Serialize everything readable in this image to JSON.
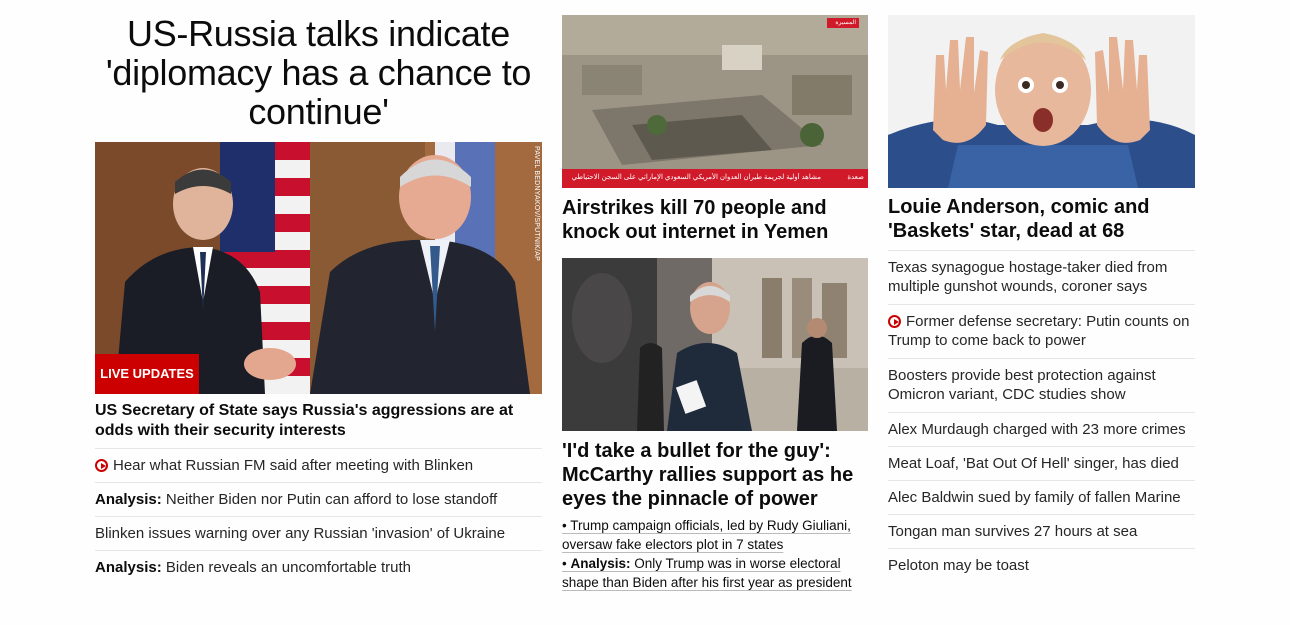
{
  "lead": {
    "headline": "US-Russia talks indicate 'diplomacy has a chance to continue'",
    "badge": "LIVE UPDATES",
    "photo_credit": "PAVEL BEDNYAKOV/SPUTNIK/AP",
    "hero_title": "US Secretary of State says Russia's aggressions are at odds with their security interests",
    "related": [
      {
        "prefix": "",
        "text": "Hear what Russian FM said after meeting with Blinken",
        "video": true
      },
      {
        "prefix": "Analysis:",
        "text": "Neither Biden nor Putin can afford to lose standoff",
        "video": false
      },
      {
        "prefix": "",
        "text": "Blinken issues warning over any Russian 'invasion' of Ukraine",
        "video": false
      },
      {
        "prefix": "Analysis:",
        "text": "Biden reveals an uncomfortable truth",
        "video": false
      }
    ]
  },
  "middle": {
    "yemen_title": "Airstrikes kill 70 people and knock out internet in Yemen",
    "yemen_caption": "مشاهد أولية لجريمة طيران العدوان الأمريكي السعودي الإماراتي على السجن الاحتياطي",
    "yemen_caption_place": "صعدة",
    "yemen_channel": "المسيرة",
    "mccarthy_title": "'I'd take a bullet for the guy': McCarthy rallies support as he eyes the pinnacle of power",
    "bullets": [
      {
        "prefix": "",
        "text": "Trump campaign officials, led by Rudy Giuliani, oversaw fake electors plot in 7 states"
      },
      {
        "prefix": "Analysis:",
        "text": "Only Trump was in worse electoral shape than Biden after his first year as president"
      }
    ]
  },
  "right": {
    "title": "Louie Anderson, comic and 'Baskets' star, dead at 68",
    "items": [
      {
        "text": "Texas synagogue hostage-taker died from multiple gunshot wounds, coroner says",
        "video": false,
        "lines": 2
      },
      {
        "text": "Former defense secretary: Putin counts on Trump to come back to power",
        "video": true,
        "lines": 2
      },
      {
        "text": "Boosters provide best protection against Omicron variant, CDC studies show",
        "video": false,
        "lines": 2
      },
      {
        "text": "Alex Murdaugh charged with 23 more crimes",
        "video": false,
        "lines": 1
      },
      {
        "text": "Meat Loaf, 'Bat Out Of Hell' singer, has died",
        "video": false,
        "lines": 1
      },
      {
        "text": "Alec Baldwin sued by family of fallen Marine",
        "video": false,
        "lines": 1
      },
      {
        "text": "Tongan man survives 27 hours at sea",
        "video": false,
        "lines": 1
      },
      {
        "text": "Peloton may be toast",
        "video": false,
        "lines": 1
      }
    ]
  },
  "colors": {
    "accent": "#cc0000",
    "divider": "#e6e6e6",
    "text": "#0c0c0c"
  }
}
